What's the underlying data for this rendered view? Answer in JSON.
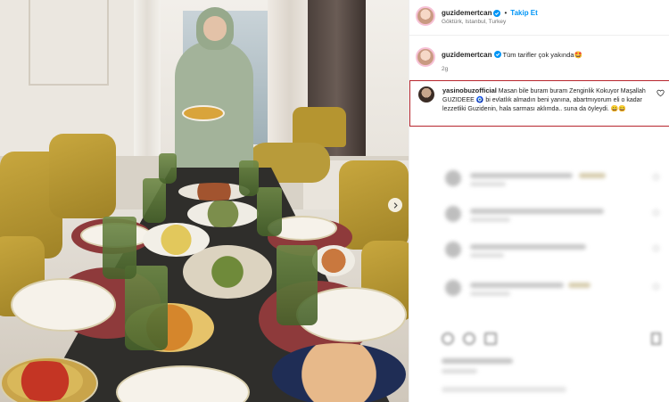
{
  "post": {
    "username": "guzidemertcan",
    "follow_label": "Takip Et",
    "location": "Göktürk, Istanbul, Turkey",
    "caption_text": "Tüm tarifler çok yakında🤩",
    "caption_time": "2g"
  },
  "highlighted_comment": {
    "username": "yasinobuzofficial",
    "text": "Masan bile buram buram Zenginlik Kokuyor Maşallah GUZIDEEE 🧿 bi evlatlık almadın beni yanına, abartmıyorum eli o kadar lezzetliki Guzidenin, hala sarması aklımda.. suna da öyleydi. 😄😄",
    "border_color": "#b7262d"
  },
  "colors": {
    "verified": "#0095f6",
    "follow": "#0095f6",
    "muted": "#737373"
  },
  "icons": {
    "verified": "verified-badge-icon",
    "heart": "heart-icon",
    "next": "chevron-right-icon"
  }
}
